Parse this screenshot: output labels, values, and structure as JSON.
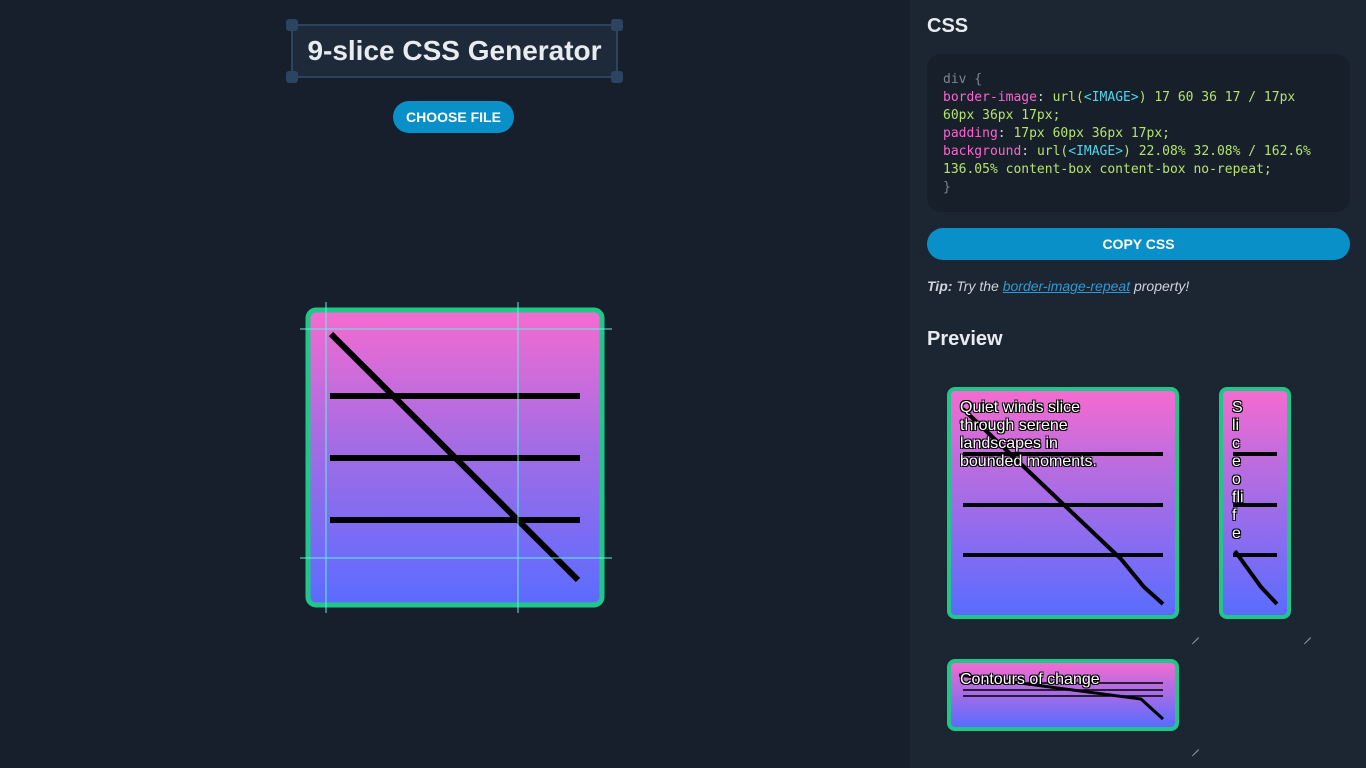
{
  "header": {
    "title": "9-slice CSS Generator"
  },
  "toolbar": {
    "choose_file_label": "CHOOSE FILE"
  },
  "sidebar": {
    "css_heading": "CSS",
    "code": {
      "open": "div {",
      "border_image_prop": "border-image",
      "border_image_fn": "url(",
      "border_image_placeholder": "<IMAGE>",
      "border_image_value": ") 17 60 36 17 / 17px 60px 36px 17px;",
      "padding_prop": "padding",
      "padding_value": "17px 60px 36px 17px;",
      "background_prop": "background",
      "background_fn": "url(",
      "background_placeholder": "<IMAGE>",
      "background_value": ") 22.08% 32.08% / 162.6% 136.05% content-box content-box no-repeat;",
      "close": "}"
    },
    "copy_label": "COPY CSS",
    "tip": {
      "label": "Tip:",
      "before": "Try the",
      "link": "border-image-repeat",
      "after": "property!"
    },
    "preview_heading": "Preview",
    "previews": [
      {
        "text": "Quiet winds slice through serene landscapes in bounded moments."
      },
      {
        "text": "Sliceoflife"
      },
      {
        "text": "Contours of change"
      }
    ]
  },
  "colors": {
    "accent": "#0a90c8",
    "border_green": "#20c789",
    "gradient_top": "#f56bd0",
    "gradient_bottom": "#5a6cff",
    "guide_lines": "#5ef2e2"
  }
}
